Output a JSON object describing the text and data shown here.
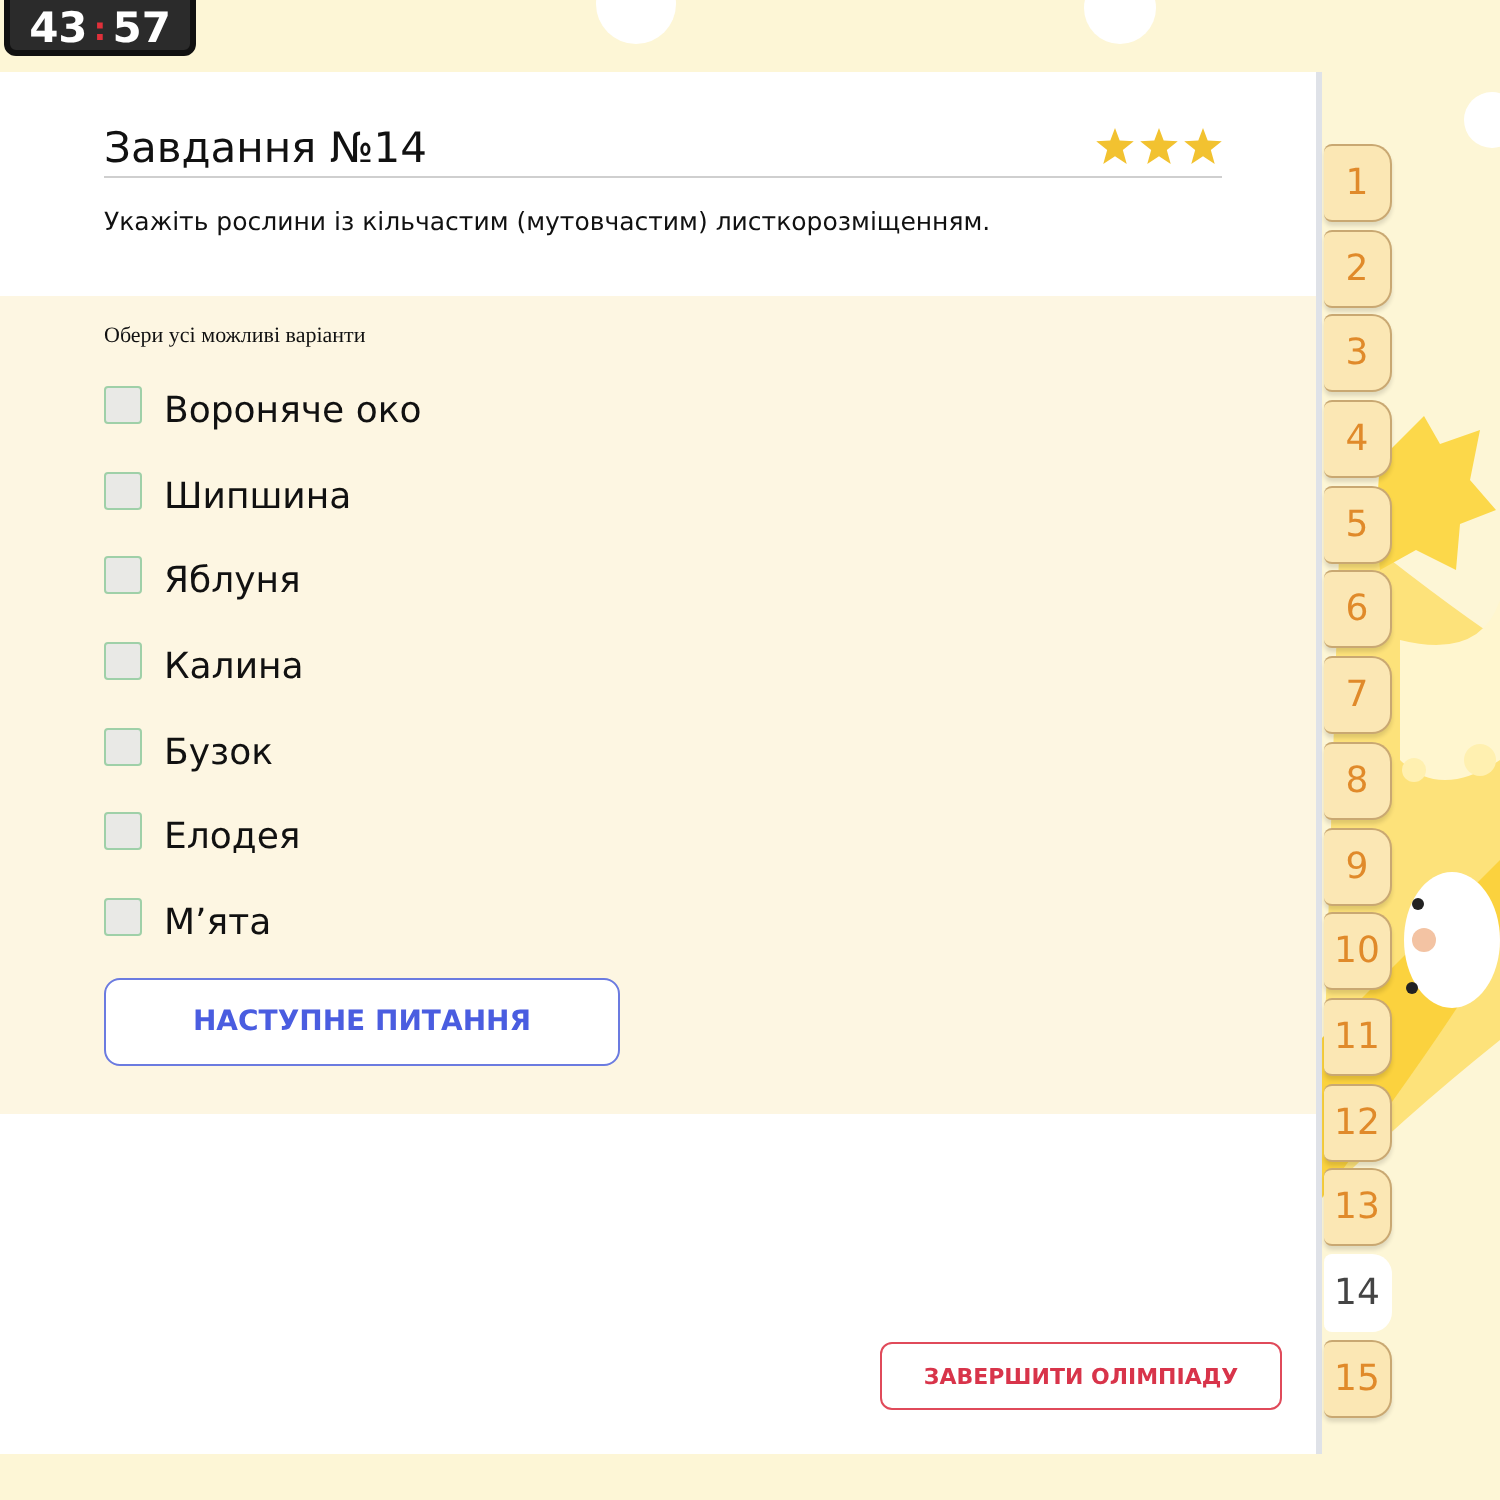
{
  "timer": {
    "minutes": "43",
    "separator": ":",
    "seconds": "57"
  },
  "task": {
    "title": "Завдання №14",
    "stars": 3,
    "question": "Укажіть рослини із кільчастим (мутовчастим) листкорозміщенням."
  },
  "hint": "Обери усі можливі варіанти",
  "options": [
    {
      "label": "Вороняче око",
      "checked": false
    },
    {
      "label": "Шипшина",
      "checked": false
    },
    {
      "label": "Яблуня",
      "checked": false
    },
    {
      "label": "Калина",
      "checked": false
    },
    {
      "label": "Бузок",
      "checked": false
    },
    {
      "label": "Елодея",
      "checked": false
    },
    {
      "label": "М’ята",
      "checked": false
    }
  ],
  "next_button": "НАСТУПНЕ ПИТАННЯ",
  "finish_button": "ЗАВЕРШИТИ ОЛІМПІАДУ",
  "question_tabs": [
    {
      "label": "1",
      "selected": false
    },
    {
      "label": "2",
      "selected": false
    },
    {
      "label": "3",
      "selected": false
    },
    {
      "label": "4",
      "selected": false
    },
    {
      "label": "5",
      "selected": false
    },
    {
      "label": "6",
      "selected": false
    },
    {
      "label": "7",
      "selected": false
    },
    {
      "label": "8",
      "selected": false
    },
    {
      "label": "9",
      "selected": false
    },
    {
      "label": "10",
      "selected": false
    },
    {
      "label": "11",
      "selected": false
    },
    {
      "label": "12",
      "selected": false
    },
    {
      "label": "13",
      "selected": false
    },
    {
      "label": "14",
      "selected": true
    },
    {
      "label": "15",
      "selected": false
    }
  ]
}
